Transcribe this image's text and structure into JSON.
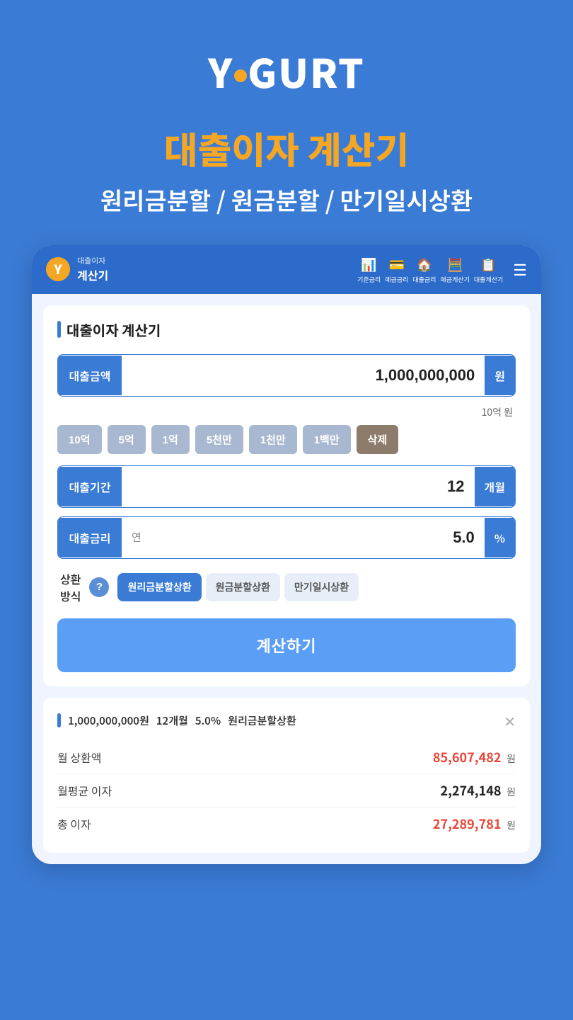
{
  "logo": {
    "text_before": "Y",
    "dot": "●",
    "text_after": "GURT"
  },
  "header": {
    "main_title": "대출이자 계산기",
    "sub_title": "원리금분할 / 원금분할 / 만기일시상환"
  },
  "app_nav": {
    "logo_letter": "Y",
    "title_top": "대출이자",
    "title_bottom": "계산기",
    "icons": [
      {
        "symbol": "📊",
        "label": "기준금리"
      },
      {
        "symbol": "💳",
        "label": "예금금리"
      },
      {
        "symbol": "🏠",
        "label": "대출금리"
      },
      {
        "symbol": "🧮",
        "label": "예금계산기"
      },
      {
        "symbol": "📋",
        "label": "대출계산기"
      }
    ]
  },
  "section_title": "대출이자 계산기",
  "form": {
    "amount_label": "대출금액",
    "amount_value": "1,000,000,000",
    "amount_unit": "원",
    "amount_hint": "10억 원",
    "quick_buttons": [
      "10억",
      "5억",
      "1억",
      "5천만",
      "1천만",
      "1백만",
      "삭제"
    ],
    "period_label": "대출기간",
    "period_value": "12",
    "period_unit": "개월",
    "rate_label": "대출금리",
    "rate_prefix": "연",
    "rate_value": "5.0",
    "rate_unit": "%",
    "repayment_label": "상환\n방식",
    "repayment_options": [
      {
        "label": "원리금분할상환",
        "active": true
      },
      {
        "label": "원금분할상환",
        "active": false
      },
      {
        "label": "만기일시상환",
        "active": false
      }
    ],
    "calc_button": "계산하기"
  },
  "result": {
    "summary_amount": "1,000,000,000원",
    "summary_period": "12개월",
    "summary_rate": "5.0%",
    "summary_type": "원리금분할상환",
    "rows": [
      {
        "label": "월 상환액",
        "value": "85,607,482",
        "unit": "원",
        "highlight": true
      },
      {
        "label": "월평균 이자",
        "value": "2,274,148",
        "unit": "원",
        "highlight": false
      },
      {
        "label": "총 이자",
        "value": "27,289,781",
        "unit": "원",
        "highlight": true
      }
    ]
  }
}
